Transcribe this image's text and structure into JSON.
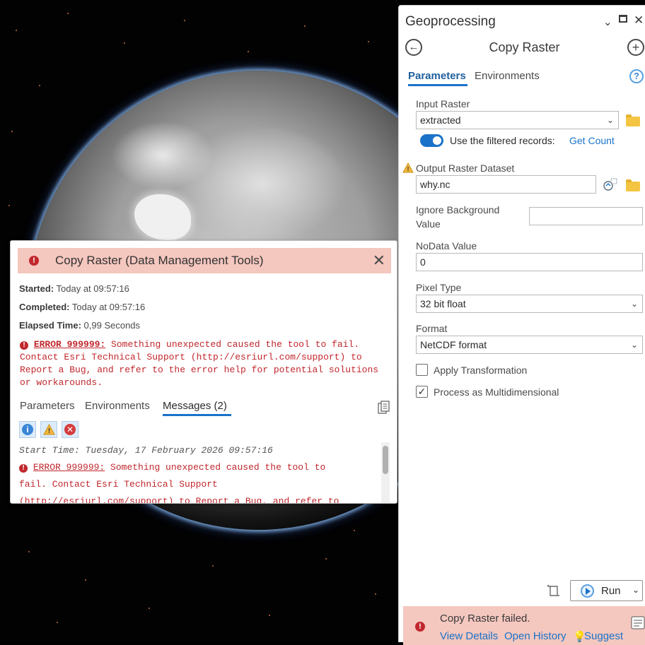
{
  "popup": {
    "title": "Copy Raster (Data Management Tools)",
    "started_label": "Started:",
    "started_value": "Today at 09:57:16",
    "completed_label": "Completed:",
    "completed_value": "Today at 09:57:16",
    "elapsed_label": "Elapsed Time:",
    "elapsed_value": "0,99 Seconds",
    "error_code": "ERROR 999999:",
    "error_text": "Something unexpected caused the tool to fail. Contact Esri Technical Support (http://esriurl.com/support) to Report a Bug, and refer to the error help for potential solutions or workarounds.",
    "tabs": {
      "parameters": "Parameters",
      "environments": "Environments",
      "messages": "Messages (2)"
    },
    "messages": {
      "start_time": "Start Time: Tuesday, 17 February 2026 09:57:16",
      "error_code": "ERROR 999999:",
      "error_text": "Something unexpected caused the tool to",
      "line2": "fail. Contact Esri Technical Support",
      "line3": "(http://esriurl.com/support) to Report a Bug, and refer to"
    },
    "filter_icons": [
      "info-icon",
      "warning-icon",
      "error-icon"
    ]
  },
  "gp": {
    "pane_title": "Geoprocessing",
    "tool_title": "Copy Raster",
    "tabs": {
      "parameters": "Parameters",
      "environments": "Environments"
    },
    "input_raster": {
      "label": "Input Raster",
      "value": "extracted"
    },
    "filtered_records": {
      "label": "Use the filtered records:",
      "link": "Get Count",
      "enabled": true
    },
    "output_raster": {
      "label": "Output Raster Dataset",
      "value": "why.nc"
    },
    "ignore_bg": {
      "label_line1": "Ignore Background",
      "label_line2": "Value",
      "value": ""
    },
    "nodata": {
      "label": "NoData Value",
      "value": "0"
    },
    "pixel_type": {
      "label": "Pixel Type",
      "value": "32 bit float"
    },
    "format": {
      "label": "Format",
      "value": "NetCDF format"
    },
    "apply_transformation": {
      "label": "Apply Transformation",
      "checked": false
    },
    "multidimensional": {
      "label": "Process as Multidimensional",
      "checked": true
    },
    "run_label": "Run",
    "status": {
      "message": "Copy Raster failed.",
      "view_details": "View Details",
      "open_history": "Open History",
      "suggest": "Suggest"
    }
  },
  "colors": {
    "accent": "#1a73c8",
    "error": "#c1272d",
    "error_banner": "#f4c7bf"
  }
}
